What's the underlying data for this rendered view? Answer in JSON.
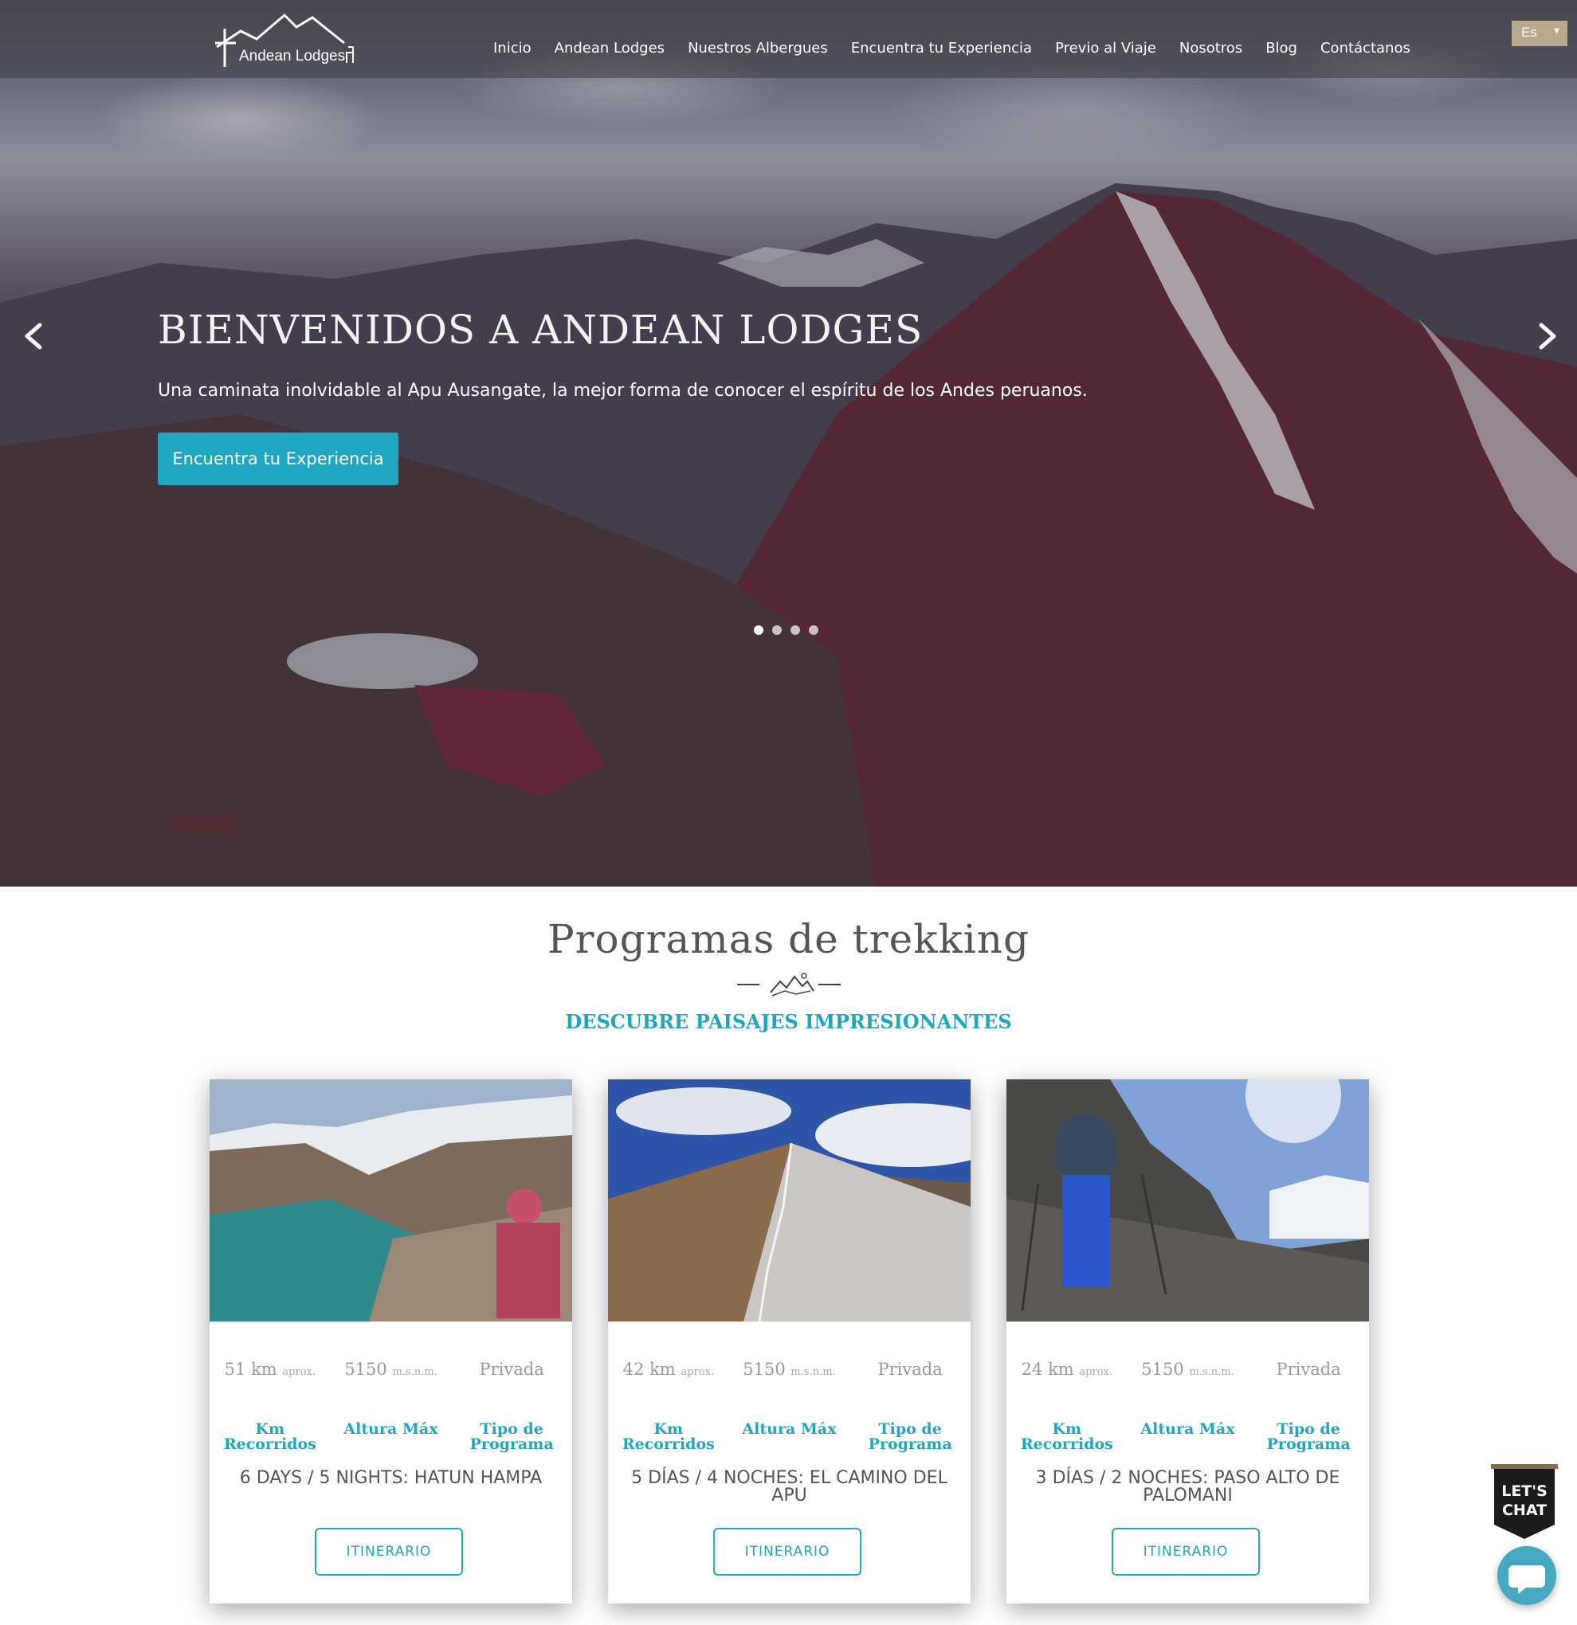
{
  "brand": {
    "logo_text": "Andean Lodges"
  },
  "nav": {
    "items": [
      {
        "label": "Inicio"
      },
      {
        "label": "Andean Lodges"
      },
      {
        "label": "Nuestros Albergues"
      },
      {
        "label": "Encuentra tu Experiencia"
      },
      {
        "label": "Previo al Viaje"
      },
      {
        "label": "Nosotros"
      },
      {
        "label": "Blog"
      },
      {
        "label": "Contáctanos"
      }
    ],
    "language": "Es"
  },
  "hero": {
    "title": "BIENVENIDOS A ANDEAN LODGES",
    "subtitle": "Una caminata inolvidable al Apu Ausangate, la mejor forma de conocer el espíritu de los Andes peruanos.",
    "cta": "Encuentra tu Experiencia",
    "slide_count": 4,
    "active_slide": 1
  },
  "section": {
    "title": "Programas de trekking",
    "subtitle": "DESCUBRE PAISAJES IMPRESIONANTES"
  },
  "cards": [
    {
      "km": "51 km",
      "km_unit": "aprox.",
      "alt": "5150",
      "alt_unit": "m.s.n.m.",
      "type": "Privada",
      "label_km": "Km Recorridos",
      "label_alt": "Altura Máx",
      "label_type": "Tipo de Programa",
      "title": "6 DAYS / 5 NIGHTS: HATUN HAMPA",
      "button": "ITINERARIO"
    },
    {
      "km": "42 km",
      "km_unit": "aprox.",
      "alt": "5150",
      "alt_unit": "m.s.n.m.",
      "type": "Privada",
      "label_km": "Km Recorridos",
      "label_alt": "Altura Máx",
      "label_type": "Tipo de Programa",
      "title": "5 DÍAS / 4 NOCHES: EL CAMINO DEL APU",
      "button": "ITINERARIO"
    },
    {
      "km": "24 km",
      "km_unit": "aprox.",
      "alt": "5150",
      "alt_unit": "m.s.n.m.",
      "type": "Privada",
      "label_km": "Km Recorridos",
      "label_alt": "Altura Máx",
      "label_type": "Tipo de Programa",
      "title": "3 DÍAS / 2 NOCHES: PASO ALTO DE PALOMANI",
      "button": "ITINERARIO"
    }
  ],
  "chat": {
    "badge_line1": "LET'S",
    "badge_line2": "CHAT"
  },
  "colors": {
    "accent": "#1ea6c2",
    "lang_bg": "#b9a98a",
    "chat": "#45a9c2"
  },
  "icons": [
    "chevron-left-icon",
    "chevron-right-icon",
    "mountains-icon",
    "chat-bubble-icon"
  ]
}
